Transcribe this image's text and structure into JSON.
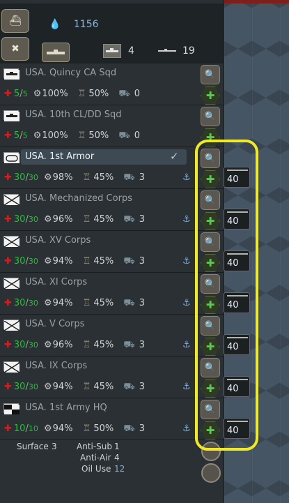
{
  "header": {
    "oil_value": "1156",
    "ship_count": "4",
    "sub_count": "19",
    "buttons": [
      "fleet-icon",
      "tools-icon",
      "ship-icon"
    ]
  },
  "units": [
    {
      "name": "USA. Quincy CA Sqd",
      "str": "5",
      "max": "5",
      "org": "100%",
      "exp": "50%",
      "supply": "0",
      "flag": "navy",
      "anchor": false,
      "tag": null
    },
    {
      "name": "USA. 10th CL/DD Sqd",
      "str": "5",
      "max": "5",
      "org": "100%",
      "exp": "50%",
      "supply": "0",
      "flag": "navy",
      "anchor": false,
      "tag": null
    },
    {
      "name": "USA. 1st Armor",
      "str": "30",
      "max": "30",
      "org": "98%",
      "exp": "45%",
      "supply": "3",
      "flag": "armor",
      "anchor": true,
      "tag": "40",
      "selected": true
    },
    {
      "name": "USA. Mechanized Corps",
      "str": "30",
      "max": "30",
      "org": "96%",
      "exp": "45%",
      "supply": "3",
      "flag": "infantry",
      "anchor": true,
      "tag": "40"
    },
    {
      "name": "USA. XV Corps",
      "str": "30",
      "max": "30",
      "org": "94%",
      "exp": "45%",
      "supply": "3",
      "flag": "infantry",
      "anchor": true,
      "tag": "40"
    },
    {
      "name": "USA. XI Corps",
      "str": "30",
      "max": "30",
      "org": "94%",
      "exp": "45%",
      "supply": "3",
      "flag": "infantry",
      "anchor": true,
      "tag": "40"
    },
    {
      "name": "USA. V Corps",
      "str": "30",
      "max": "30",
      "org": "96%",
      "exp": "45%",
      "supply": "3",
      "flag": "infantry",
      "anchor": true,
      "tag": "40"
    },
    {
      "name": "USA. IX Corps",
      "str": "30",
      "max": "30",
      "org": "94%",
      "exp": "45%",
      "supply": "3",
      "flag": "infantry",
      "anchor": true,
      "tag": "40"
    },
    {
      "name": "USA. 1st Army HQ",
      "str": "10",
      "max": "10",
      "org": "94%",
      "exp": "50%",
      "supply": "3",
      "flag": "hq",
      "anchor": true,
      "tag": "40"
    }
  ],
  "footer": {
    "surface_label": "Surface",
    "surface_value": "3",
    "antisub_label": "Anti-Sub",
    "antisub_value": "1",
    "antiair_label": "Anti-Air",
    "antiair_value": "4",
    "oiluse_label": "Oil Use",
    "oiluse_value": "12"
  },
  "colors": {
    "highlight": "#f0ea24",
    "strength": "#28c038",
    "cross": "#d11f1f",
    "oil": "#8fb5d8"
  }
}
